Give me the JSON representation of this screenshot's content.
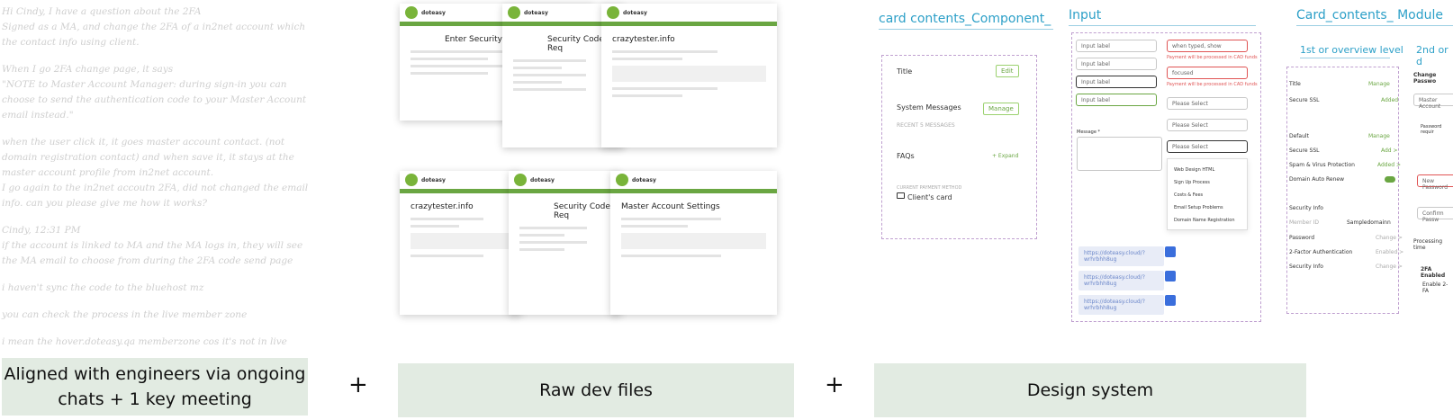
{
  "chat": [
    "Hi Cindy, I have a question about the 2FA",
    "Signed as a MA, and change the 2FA of a in2net account which the contact info using client.",
    "When I go 2FA change page, it says",
    "\"NOTE to Master Account Manager: during sign-in you can choose to send the authentication code to your Master Account email instead.\"",
    "when the user click it, it goes master account contact. (not domain registration contact) and when save it, it stays at the master account profile from in2net account.",
    "I go again to the in2net accoutn 2FA, did not changed the email info. can you please give me how it works?",
    "Cindy, 12:31 PM",
    "if the account is linked to MA and the MA logs in, they will see the MA email to choose from during the 2FA code send page",
    "i haven't sync the code to the bluehost mz",
    "you can check the process in the live member zone",
    "i mean the hover.doteasy.qa memberzone cos it's not in live"
  ],
  "captions": {
    "c1": "Aligned with engineers via ongoing chats + 1 key meeting",
    "c2": "Raw dev files",
    "c3": "Design system",
    "plus": "+"
  },
  "dev": {
    "logo": "doteasy",
    "t1": "Enter Security Code",
    "t2": "Security Code Req",
    "t3": "crazytester.info",
    "t4": "crazytester.info",
    "t5": "Security Code Req",
    "t6": "Master Account Settings"
  },
  "design": {
    "h1": "card contents_Component_",
    "h2": "Input",
    "h3": "Card_contents_ Module",
    "level1": "1st or overview level",
    "level2": "2nd or d",
    "title": "Title",
    "edit": "Edit",
    "sysmsg": "System Messages",
    "manage": "Manage",
    "recent": "RECENT 5 MESSAGES",
    "faqs": "FAQs",
    "expand": "+ Expand",
    "payment": "CURRENT PAYMENT METHOD",
    "client": "Client's card",
    "inputs": [
      "Input label",
      "Input label",
      "Input label",
      "Input label"
    ],
    "inputsR": [
      "when typed, show",
      "focused",
      "Please Select",
      "Please Select",
      "Please Select"
    ],
    "errors": [
      "Payment will be processed in CAD funds",
      "Payment will be processed in CAD funds"
    ],
    "message": "Message *",
    "options": [
      "Web Design HTML",
      "Sign Up Process",
      "Costs & Fees",
      "Email Setup Problems",
      "Domain Name Registration"
    ],
    "links": [
      "https://doteasy.cloud/?wrhrbhh8ug",
      "https://doteasy.cloud/?wrhrbhh8ug",
      "https://doteasy.cloud/?wrhrbhh8ug"
    ],
    "mod": [
      "Title",
      "Secure SSL",
      "Default",
      "Secure SSL",
      "Spam & Virus Protection",
      "Domain Auto Renew",
      "Security Info",
      "Member ID",
      "Password",
      "2-Factor Authentication",
      "Security Info"
    ],
    "modR": [
      "Manage",
      "Added",
      "Manage",
      "Add >",
      "Added >",
      "",
      "",
      "Sampledomainn",
      "Change >",
      "Enabled >",
      "Change >"
    ],
    "right": [
      "Change Passwo",
      "Master Account",
      "Password requir",
      "New Password",
      "Confirm Passw",
      "Processing time",
      "2FA Enabled",
      "Enable 2-FA"
    ]
  }
}
